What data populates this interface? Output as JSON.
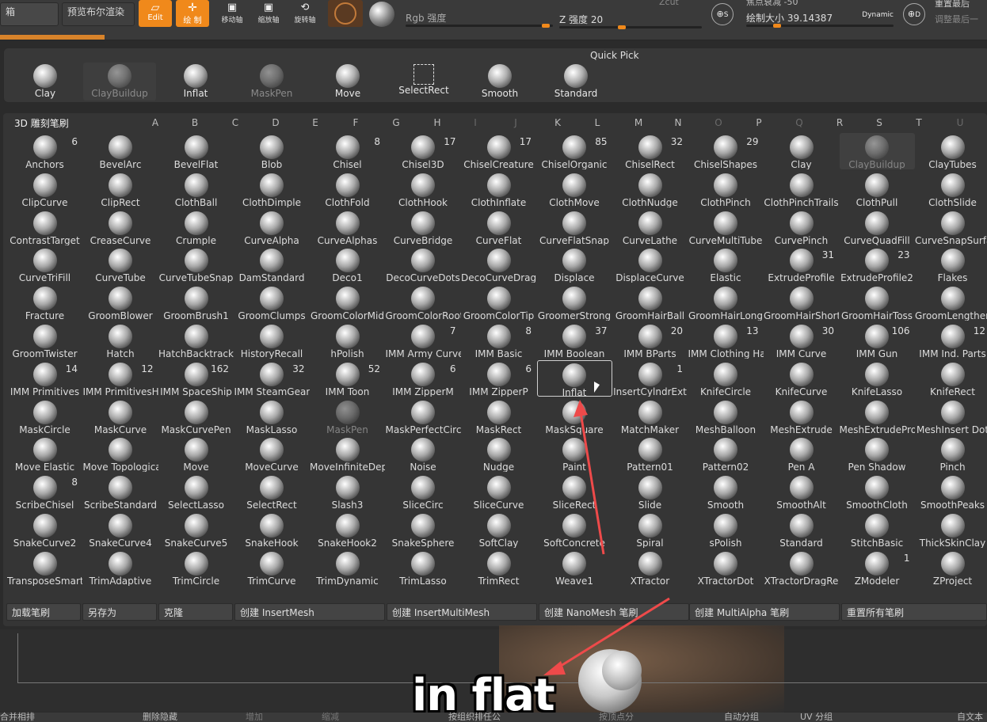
{
  "toolbar": {
    "box1": "箱",
    "preview_label": "预览布尔渲染",
    "edit_label": "Edit",
    "draw_label": "绘 制",
    "move_label": "移动轴",
    "scale_label": "缩放轴",
    "rotate_label": "旋转轴",
    "rgb_label": "Rgb 强度",
    "z_label": "Z 强度 20",
    "zcut_label": "Zcut",
    "draw_size_label": "绘制大小 39.14387",
    "dynamic_label": "Dynamic",
    "s_label": "S",
    "d_label": "D",
    "right_top": "重置最后",
    "right_bottom": "调整最后一",
    "partial_label": "焦点衰减 -50"
  },
  "quick_pick": {
    "title": "Quick Pick",
    "items": [
      {
        "label": "Clay"
      },
      {
        "label": "ClayBuildup"
      },
      {
        "label": "Inflat"
      },
      {
        "label": "MaskPen"
      },
      {
        "label": "Move"
      },
      {
        "label": "SelectRect"
      },
      {
        "label": "Smooth"
      },
      {
        "label": "Standard"
      }
    ]
  },
  "brush_panel": {
    "title": "3D 雕刻笔刷",
    "letters": [
      "A",
      "B",
      "C",
      "D",
      "E",
      "F",
      "G",
      "H",
      "I",
      "J",
      "K",
      "L",
      "M",
      "N",
      "O",
      "P",
      "Q",
      "R",
      "S",
      "T",
      "U"
    ],
    "rows": [
      [
        {
          "l": "Anchors",
          "n": "6"
        },
        {
          "l": "BevelArc"
        },
        {
          "l": "BevelFlat"
        },
        {
          "l": "Blob"
        },
        {
          "l": "Chisel",
          "n": "8"
        },
        {
          "l": "Chisel3D",
          "n": "17"
        },
        {
          "l": "ChiselCreature",
          "n": "17"
        },
        {
          "l": "ChiselOrganic",
          "n": "85"
        },
        {
          "l": "ChiselRect",
          "n": "32"
        },
        {
          "l": "ChiselShapes",
          "n": "29"
        },
        {
          "l": "Clay"
        },
        {
          "l": "ClayBuildup"
        },
        {
          "l": "ClayTubes"
        }
      ],
      [
        {
          "l": "ClipCurve"
        },
        {
          "l": "ClipRect"
        },
        {
          "l": "ClothBall"
        },
        {
          "l": "ClothDimple"
        },
        {
          "l": "ClothFold"
        },
        {
          "l": "ClothHook"
        },
        {
          "l": "ClothInflate"
        },
        {
          "l": "ClothMove"
        },
        {
          "l": "ClothNudge"
        },
        {
          "l": "ClothPinch"
        },
        {
          "l": "ClothPinchTrails"
        },
        {
          "l": "ClothPull"
        },
        {
          "l": "ClothSlide"
        }
      ],
      [
        {
          "l": "ContrastTarget"
        },
        {
          "l": "CreaseCurve"
        },
        {
          "l": "Crumple"
        },
        {
          "l": "CurveAlpha"
        },
        {
          "l": "CurveAlphas"
        },
        {
          "l": "CurveBridge"
        },
        {
          "l": "CurveFlat"
        },
        {
          "l": "CurveFlatSnap"
        },
        {
          "l": "CurveLathe"
        },
        {
          "l": "CurveMultiTube"
        },
        {
          "l": "CurvePinch"
        },
        {
          "l": "CurveQuadFill"
        },
        {
          "l": "CurveSnapSurfa"
        }
      ],
      [
        {
          "l": "CurveTriFill"
        },
        {
          "l": "CurveTube"
        },
        {
          "l": "CurveTubeSnap"
        },
        {
          "l": "DamStandard"
        },
        {
          "l": "Deco1"
        },
        {
          "l": "DecoCurveDots"
        },
        {
          "l": "DecoCurveDragD"
        },
        {
          "l": "Displace"
        },
        {
          "l": "DisplaceCurve"
        },
        {
          "l": "Elastic"
        },
        {
          "l": "ExtrudeProfile",
          "n": "31"
        },
        {
          "l": "ExtrudeProfile2",
          "n": "23"
        },
        {
          "l": "Flakes"
        }
      ],
      [
        {
          "l": "Fracture"
        },
        {
          "l": "GroomBlower"
        },
        {
          "l": "GroomBrush1"
        },
        {
          "l": "GroomClumps"
        },
        {
          "l": "GroomColorMid"
        },
        {
          "l": "GroomColorRoot"
        },
        {
          "l": "GroomColorTip"
        },
        {
          "l": "GroomerStrong"
        },
        {
          "l": "GroomHairBall"
        },
        {
          "l": "GroomHairLong"
        },
        {
          "l": "GroomHairShort"
        },
        {
          "l": "GroomHairToss"
        },
        {
          "l": "GroomLengthen"
        }
      ],
      [
        {
          "l": "GroomTwister"
        },
        {
          "l": "Hatch"
        },
        {
          "l": "HatchBacktrack"
        },
        {
          "l": "HistoryRecall"
        },
        {
          "l": "hPolish"
        },
        {
          "l": "IMM Army Curve",
          "n": "7"
        },
        {
          "l": "IMM Basic",
          "n": "8"
        },
        {
          "l": "IMM Boolean",
          "n": "37"
        },
        {
          "l": "IMM BParts",
          "n": "20"
        },
        {
          "l": "IMM Clothing Ha",
          "n": "13"
        },
        {
          "l": "IMM Curve",
          "n": "30"
        },
        {
          "l": "IMM Gun",
          "n": "106"
        },
        {
          "l": "IMM Ind. Parts",
          "n": "12"
        }
      ],
      [
        {
          "l": "IMM Primitives",
          "n": "14"
        },
        {
          "l": "IMM PrimitivesH",
          "n": "12"
        },
        {
          "l": "IMM SpaceShip",
          "n": "162"
        },
        {
          "l": "IMM SteamGears",
          "n": "32"
        },
        {
          "l": "IMM Toon",
          "n": "52"
        },
        {
          "l": "IMM ZipperM",
          "n": "6"
        },
        {
          "l": "IMM ZipperP",
          "n": "6"
        },
        {
          "l": "Inflat"
        },
        {
          "l": "InsertCylndrExt",
          "n": "1"
        },
        {
          "l": "KnifeCircle"
        },
        {
          "l": "KnifeCurve"
        },
        {
          "l": "KnifeLasso"
        },
        {
          "l": "KnifeRect"
        }
      ],
      [
        {
          "l": "MaskCircle"
        },
        {
          "l": "MaskCurve"
        },
        {
          "l": "MaskCurvePen"
        },
        {
          "l": "MaskLasso"
        },
        {
          "l": "MaskPen"
        },
        {
          "l": "MaskPerfectCirc"
        },
        {
          "l": "MaskRect"
        },
        {
          "l": "MaskSquare"
        },
        {
          "l": "MatchMaker"
        },
        {
          "l": "MeshBalloon"
        },
        {
          "l": "MeshExtrude"
        },
        {
          "l": "MeshExtrudePro"
        },
        {
          "l": "MeshInsert Dot"
        }
      ],
      [
        {
          "l": "Move Elastic"
        },
        {
          "l": "Move Topologica"
        },
        {
          "l": "Move"
        },
        {
          "l": "MoveCurve"
        },
        {
          "l": "MoveInfiniteDep"
        },
        {
          "l": "Noise"
        },
        {
          "l": "Nudge"
        },
        {
          "l": "Paint"
        },
        {
          "l": "Pattern01"
        },
        {
          "l": "Pattern02"
        },
        {
          "l": "Pen A"
        },
        {
          "l": "Pen Shadow"
        },
        {
          "l": "Pinch"
        }
      ],
      [
        {
          "l": "ScribeChisel",
          "n": "8"
        },
        {
          "l": "ScribeStandard"
        },
        {
          "l": "SelectLasso"
        },
        {
          "l": "SelectRect"
        },
        {
          "l": "Slash3"
        },
        {
          "l": "SliceCirc"
        },
        {
          "l": "SliceCurve"
        },
        {
          "l": "SliceRect"
        },
        {
          "l": "Slide"
        },
        {
          "l": "Smooth"
        },
        {
          "l": "SmoothAlt"
        },
        {
          "l": "SmoothCloth"
        },
        {
          "l": "SmoothPeaks"
        }
      ],
      [
        {
          "l": "SnakeCurve2"
        },
        {
          "l": "SnakeCurve4"
        },
        {
          "l": "SnakeCurve5"
        },
        {
          "l": "SnakeHook"
        },
        {
          "l": "SnakeHook2"
        },
        {
          "l": "SnakeSphere"
        },
        {
          "l": "SoftClay"
        },
        {
          "l": "SoftConcrete"
        },
        {
          "l": "Spiral"
        },
        {
          "l": "sPolish"
        },
        {
          "l": "Standard"
        },
        {
          "l": "StitchBasic"
        },
        {
          "l": "ThickSkinClay"
        }
      ],
      [
        {
          "l": "TransposeSmart"
        },
        {
          "l": "TrimAdaptive"
        },
        {
          "l": "TrimCircle"
        },
        {
          "l": "TrimCurve"
        },
        {
          "l": "TrimDynamic"
        },
        {
          "l": "TrimLasso"
        },
        {
          "l": "TrimRect"
        },
        {
          "l": "Weave1"
        },
        {
          "l": "XTractor"
        },
        {
          "l": "XTractorDot"
        },
        {
          "l": "XTractorDragRe"
        },
        {
          "l": "ZModeler",
          "n": "1"
        },
        {
          "l": "ZProject"
        }
      ]
    ]
  },
  "bottom_buttons": [
    {
      "label": "加载笔刷"
    },
    {
      "label": "另存为"
    },
    {
      "label": "克隆"
    },
    {
      "label": "创建 InsertMesh"
    },
    {
      "label": "创建 InsertMultiMesh"
    },
    {
      "label": "创建 NanoMesh 笔刷"
    },
    {
      "label": "创建 MultiAlpha 笔刷"
    },
    {
      "label": "重置所有笔刷"
    }
  ],
  "caption": "in flat",
  "statusbar": {
    "s1": "合并相排",
    "s2": "删除隐藏",
    "s3": "增加",
    "s4": "缩减",
    "s5": "按组织排任公",
    "s6": "按顶点分",
    "s7": "自动分组",
    "s8": "UV 分组",
    "s9": "自文本"
  }
}
